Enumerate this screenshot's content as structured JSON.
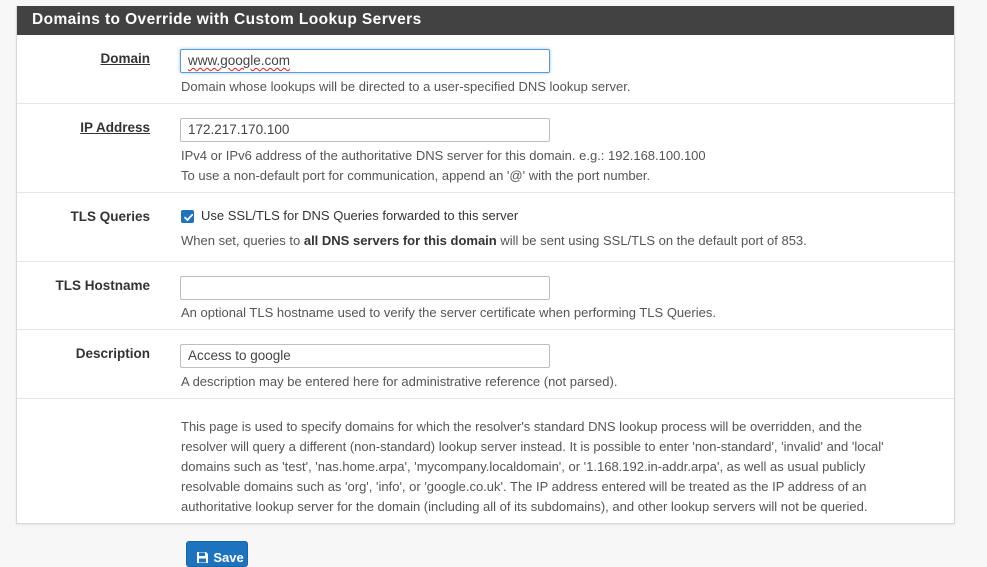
{
  "section": {
    "title": "Domains to Override with Custom Lookup Servers"
  },
  "fields": {
    "domain": {
      "label": "Domain",
      "value": "www.google.com",
      "help": "Domain whose lookups will be directed to a user-specified DNS lookup server."
    },
    "ip_address": {
      "label": "IP Address",
      "value": "172.217.170.100",
      "help_line1": "IPv4 or IPv6 address of the authoritative DNS server for this domain. e.g.: 192.168.100.100",
      "help_line2": "To use a non-default port for communication, append an '@' with the port number."
    },
    "tls_queries": {
      "label": "TLS Queries",
      "checked": true,
      "checkbox_label": "Use SSL/TLS for DNS Queries forwarded to this server",
      "help_prefix": "When set, queries to ",
      "help_bold": "all DNS servers for this domain",
      "help_suffix": " will be sent using SSL/TLS on the default port of 853."
    },
    "tls_hostname": {
      "label": "TLS Hostname",
      "value": "",
      "help": "An optional TLS hostname used to verify the server certificate when performing TLS Queries."
    },
    "description": {
      "label": "Description",
      "value": "Access to google",
      "help": "A description may be entered here for administrative reference (not parsed)."
    }
  },
  "info": {
    "line1": "This page is used to specify domains for which the resolver's standard DNS lookup process will be overridden, and the",
    "line2": "resolver will query a different (non-standard) lookup server instead. It is possible to enter 'non-standard', 'invalid' and 'local'",
    "line3": "domains such as 'test', 'nas.home.arpa', 'mycompany.localdomain', or '1.168.192.in-addr.arpa', as well as usual publicly",
    "line4": "resolvable domains such as 'org', 'info', or 'google.co.uk'. The IP address entered will be treated as the IP address of an",
    "line5": "authoritative lookup server for the domain (including all of its subdomains), and other lookup servers will not be queried."
  },
  "actions": {
    "save_label": "Save",
    "save_icon": "save-icon",
    "accent_color": "#1e73be"
  }
}
